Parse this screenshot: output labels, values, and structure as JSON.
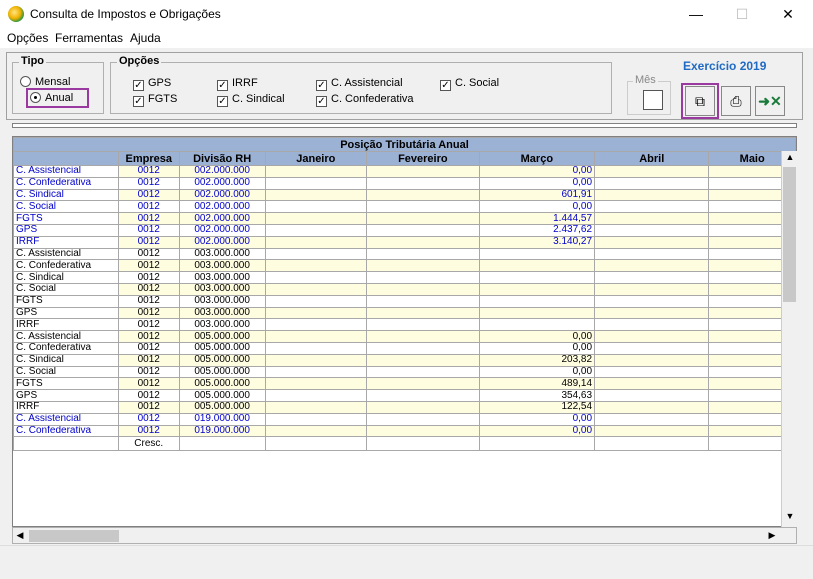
{
  "window": {
    "title": "Consulta de Impostos e Obrigações",
    "minimize": "—",
    "maximize": "☐",
    "close": "✕"
  },
  "menu": [
    "Opções",
    "Ferramentas",
    "Ajuda"
  ],
  "tipo": {
    "title": "Tipo",
    "mensal": "Mensal",
    "anual": "Anual"
  },
  "opcoes": {
    "title": "Opções",
    "gps": "GPS",
    "fgts": "FGTS",
    "irrf": "IRRF",
    "sindical": "C. Sindical",
    "assistencial": "C. Assistencial",
    "confederativa": "C. Confederativa",
    "social": "C. Social"
  },
  "mes": {
    "label": "Mês"
  },
  "exercicio": "Exercício 2019",
  "grid": {
    "caption": "Posição Tributária Anual",
    "columns": [
      "",
      "Empresa",
      "Divisão RH",
      "Janeiro",
      "Fevereiro",
      "Março",
      "Abril",
      "Maio"
    ],
    "rows": [
      {
        "n": "C. Assistencial",
        "e": "0012",
        "d": "002.000.000",
        "m": "0,00",
        "b": true
      },
      {
        "n": "C. Confederativa",
        "e": "0012",
        "d": "002.000.000",
        "m": "0,00",
        "b": true
      },
      {
        "n": "C. Sindical",
        "e": "0012",
        "d": "002.000.000",
        "m": "601,91",
        "b": true
      },
      {
        "n": "C. Social",
        "e": "0012",
        "d": "002.000.000",
        "m": "0,00",
        "b": true
      },
      {
        "n": "FGTS",
        "e": "0012",
        "d": "002.000.000",
        "m": "1.444,57",
        "b": true
      },
      {
        "n": "GPS",
        "e": "0012",
        "d": "002.000.000",
        "m": "2.437,62",
        "b": true
      },
      {
        "n": "IRRF",
        "e": "0012",
        "d": "002.000.000",
        "m": "3.140,27",
        "b": true
      },
      {
        "n": "C. Assistencial",
        "e": "0012",
        "d": "003.000.000",
        "m": "",
        "b": false
      },
      {
        "n": "C. Confederativa",
        "e": "0012",
        "d": "003.000.000",
        "m": "",
        "b": false
      },
      {
        "n": "C. Sindical",
        "e": "0012",
        "d": "003.000.000",
        "m": "",
        "b": false
      },
      {
        "n": "C. Social",
        "e": "0012",
        "d": "003.000.000",
        "m": "",
        "b": false
      },
      {
        "n": "FGTS",
        "e": "0012",
        "d": "003.000.000",
        "m": "",
        "b": false
      },
      {
        "n": "GPS",
        "e": "0012",
        "d": "003.000.000",
        "m": "",
        "b": false
      },
      {
        "n": "IRRF",
        "e": "0012",
        "d": "003.000.000",
        "m": "",
        "b": false
      },
      {
        "n": "C. Assistencial",
        "e": "0012",
        "d": "005.000.000",
        "m": "0,00",
        "b": false
      },
      {
        "n": "C. Confederativa",
        "e": "0012",
        "d": "005.000.000",
        "m": "0,00",
        "b": false
      },
      {
        "n": "C. Sindical",
        "e": "0012",
        "d": "005.000.000",
        "m": "203,82",
        "b": false
      },
      {
        "n": "C. Social",
        "e": "0012",
        "d": "005.000.000",
        "m": "0,00",
        "b": false
      },
      {
        "n": "FGTS",
        "e": "0012",
        "d": "005.000.000",
        "m": "489,14",
        "b": false
      },
      {
        "n": "GPS",
        "e": "0012",
        "d": "005.000.000",
        "m": "354,63",
        "b": false
      },
      {
        "n": "IRRF",
        "e": "0012",
        "d": "005.000.000",
        "m": "122,54",
        "b": false
      },
      {
        "n": "C. Assistencial",
        "e": "0012",
        "d": "019.000.000",
        "m": "0,00",
        "b": true
      },
      {
        "n": "C. Confederativa",
        "e": "0012",
        "d": "019.000.000",
        "m": "0,00",
        "b": true
      }
    ],
    "footer": {
      "empresa": "Cresc."
    }
  }
}
